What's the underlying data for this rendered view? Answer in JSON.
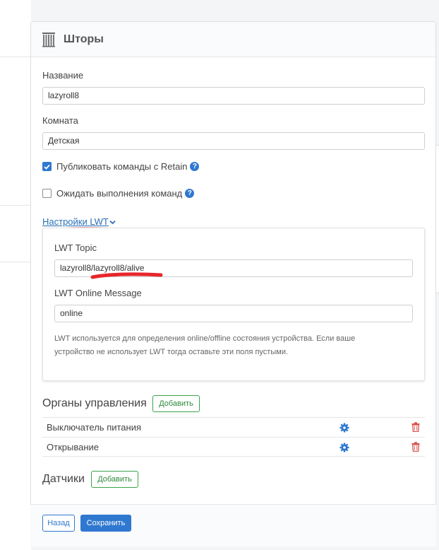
{
  "header": {
    "title": "Шторы",
    "icon": "curtains-icon"
  },
  "form": {
    "name_label": "Название",
    "name_value": "lazyroll8",
    "room_label": "Комната",
    "room_value": "Детская",
    "retain_label": "Публиковать команды с Retain",
    "retain_checked": true,
    "wait_label": "Ожидать выполнения команд",
    "wait_checked": false,
    "help_glyph": "?"
  },
  "lwt": {
    "toggle_label": "Настройки LWT",
    "toggle_icon": "chevron-down-icon",
    "topic_label": "LWT Topic",
    "topic_value": "lazyroll8/lazyroll8/alive",
    "online_label": "LWT Online Message",
    "online_value": "online",
    "note": "LWT используется для определения online/offline состояния устройства. Если ваше устройство не использует LWT тогда оставьте эти поля пустыми."
  },
  "controls": {
    "title": "Органы управления",
    "add_label": "Добавить",
    "items": [
      {
        "label": "Выключатель питания"
      },
      {
        "label": "Открывание"
      }
    ]
  },
  "sensors": {
    "title": "Датчики",
    "add_label": "Добавить"
  },
  "footer": {
    "back_label": "Назад",
    "save_label": "Сохранить"
  },
  "colors": {
    "primary": "#2f78d0",
    "success": "#3ba34b",
    "danger": "#d9534f",
    "annotation": "#e8262a"
  }
}
